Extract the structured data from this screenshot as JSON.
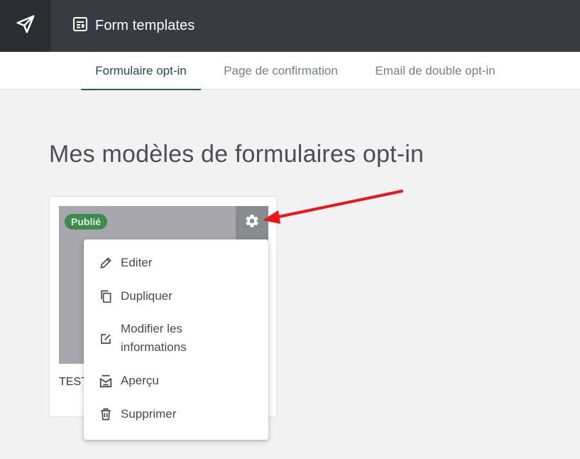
{
  "header": {
    "title": "Form templates",
    "logo_icon": "paper-plane-icon",
    "title_icon": "form-template-icon"
  },
  "tabs": [
    {
      "label": "Formulaire opt-in",
      "active": true
    },
    {
      "label": "Page de confirmation",
      "active": false
    },
    {
      "label": "Email de double opt-in",
      "active": false
    }
  ],
  "main": {
    "heading": "Mes modèles de formulaires opt-in"
  },
  "card": {
    "status_badge": "Publié",
    "name": "TEST",
    "settings_icon": "gear-icon"
  },
  "menu": {
    "items": [
      {
        "label": "Editer",
        "icon": "pencil-icon"
      },
      {
        "label": "Dupliquer",
        "icon": "copy-icon"
      },
      {
        "label": "Modifier les\ninformations",
        "icon": "edit-info-icon"
      },
      {
        "label": "Aperçu",
        "icon": "preview-icon"
      },
      {
        "label": "Supprimer",
        "icon": "trash-icon"
      }
    ]
  },
  "colors": {
    "topbar": "#383b42",
    "logo_bg": "#2b2d33",
    "active_tab": "#245a6e",
    "badge_bg": "#3e8a4f",
    "annotation_arrow": "#e8171b"
  }
}
